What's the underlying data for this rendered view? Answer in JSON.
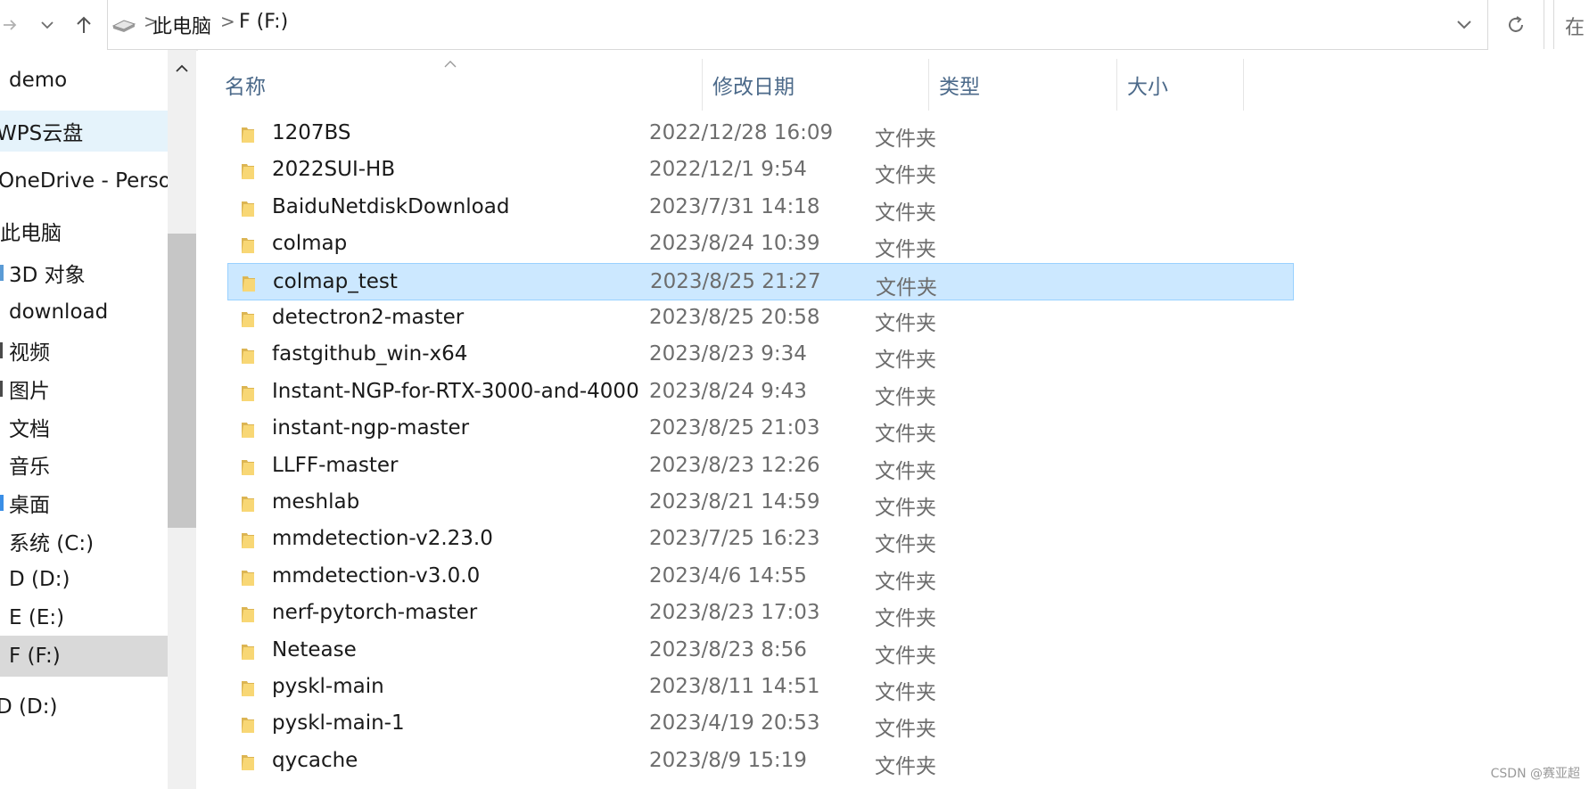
{
  "toolbar": {
    "forward_icon": "arrow-right-icon",
    "recent_icon": "chevron-down-icon",
    "up_icon": "arrow-up-icon"
  },
  "address_bar": {
    "segments": [
      "此电脑",
      "F (F:)"
    ],
    "separator": ">",
    "dropdown_icon": "chevron-down-icon",
    "refresh_icon": "refresh-icon"
  },
  "search": {
    "placeholder": "在"
  },
  "sidebar": {
    "items": [
      {
        "label": "demo"
      },
      {
        "label": "WPS云盘"
      },
      {
        "label": "OneDrive - Personal"
      },
      {
        "label": "此电脑"
      },
      {
        "label": "3D 对象"
      },
      {
        "label": "download"
      },
      {
        "label": "视频"
      },
      {
        "label": "图片"
      },
      {
        "label": "文档"
      },
      {
        "label": "音乐"
      },
      {
        "label": "桌面"
      },
      {
        "label": "系统 (C:)"
      },
      {
        "label": "D (D:)"
      },
      {
        "label": "E (E:)"
      },
      {
        "label": "F (F:)"
      },
      {
        "label": "D (D:)"
      }
    ]
  },
  "columns": {
    "name": "名称",
    "date": "修改日期",
    "type": "类型",
    "size": "大小"
  },
  "files": [
    {
      "name": "1207BS",
      "date": "2022/12/28 16:09",
      "type": "文件夹"
    },
    {
      "name": "2022SUI-HB",
      "date": "2022/12/1 9:54",
      "type": "文件夹"
    },
    {
      "name": "BaiduNetdiskDownload",
      "date": "2023/7/31 14:18",
      "type": "文件夹"
    },
    {
      "name": "colmap",
      "date": "2023/8/24 10:39",
      "type": "文件夹"
    },
    {
      "name": "colmap_test",
      "date": "2023/8/25 21:27",
      "type": "文件夹"
    },
    {
      "name": "detectron2-master",
      "date": "2023/8/25 20:58",
      "type": "文件夹"
    },
    {
      "name": "fastgithub_win-x64",
      "date": "2023/8/23 9:34",
      "type": "文件夹"
    },
    {
      "name": "Instant-NGP-for-RTX-3000-and-4000",
      "date": "2023/8/24 9:43",
      "type": "文件夹"
    },
    {
      "name": "instant-ngp-master",
      "date": "2023/8/25 21:03",
      "type": "文件夹"
    },
    {
      "name": "LLFF-master",
      "date": "2023/8/23 12:26",
      "type": "文件夹"
    },
    {
      "name": "meshlab",
      "date": "2023/8/21 14:59",
      "type": "文件夹"
    },
    {
      "name": "mmdetection-v2.23.0",
      "date": "2023/7/25 16:23",
      "type": "文件夹"
    },
    {
      "name": "mmdetection-v3.0.0",
      "date": "2023/4/6 14:55",
      "type": "文件夹"
    },
    {
      "name": "nerf-pytorch-master",
      "date": "2023/8/23 17:03",
      "type": "文件夹"
    },
    {
      "name": "Netease",
      "date": "2023/8/23 8:56",
      "type": "文件夹"
    },
    {
      "name": "pyskl-main",
      "date": "2023/8/11 14:51",
      "type": "文件夹"
    },
    {
      "name": "pyskl-main-1",
      "date": "2023/4/19 20:53",
      "type": "文件夹"
    },
    {
      "name": "qycache",
      "date": "2023/8/9 15:19",
      "type": "文件夹"
    }
  ],
  "watermark": "CSDN @赛亚超",
  "colors": {
    "selection_bg": "#cce8ff",
    "selection_border": "#99d1ff",
    "header_text": "#4c6a8a",
    "folder_yellow": "#f8d775"
  }
}
